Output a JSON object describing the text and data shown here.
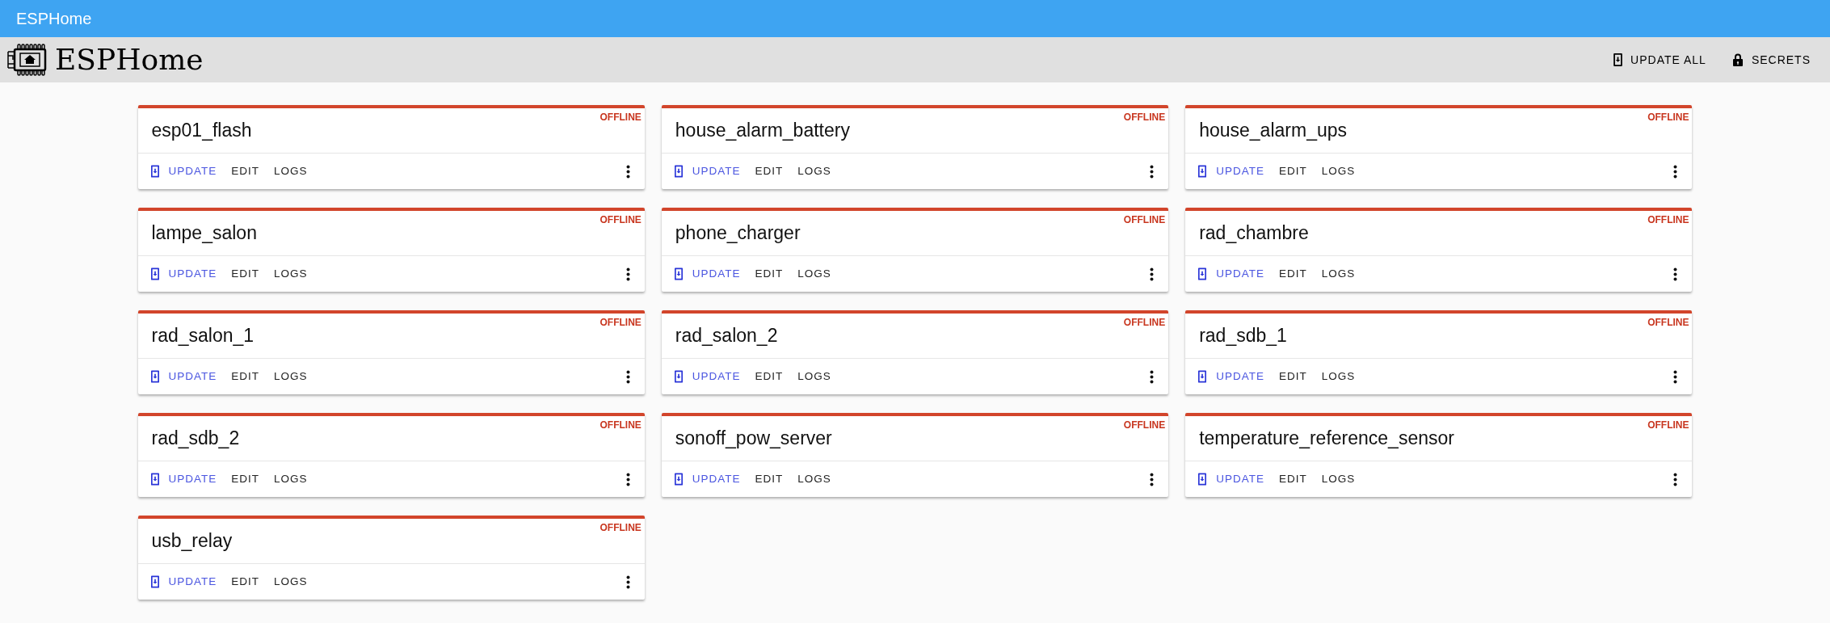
{
  "top_bar": {
    "title": "ESPHome"
  },
  "header": {
    "title": "ESPHome",
    "actions": [
      {
        "kind": "update",
        "label": "UPDATE ALL"
      },
      {
        "kind": "lock",
        "label": "SECRETS"
      }
    ]
  },
  "devices": [
    {
      "name": "esp01_flash",
      "status": "OFFLINE",
      "online": false,
      "actions": [
        "UPDATE",
        "EDIT",
        "LOGS"
      ]
    },
    {
      "name": "house_alarm_battery",
      "status": "OFFLINE",
      "online": false,
      "actions": [
        "UPDATE",
        "EDIT",
        "LOGS"
      ]
    },
    {
      "name": "house_alarm_ups",
      "status": "OFFLINE",
      "online": false,
      "actions": [
        "UPDATE",
        "EDIT",
        "LOGS"
      ]
    },
    {
      "name": "lampe_salon",
      "status": "OFFLINE",
      "online": false,
      "actions": [
        "UPDATE",
        "EDIT",
        "LOGS"
      ]
    },
    {
      "name": "phone_charger",
      "status": "OFFLINE",
      "online": false,
      "actions": [
        "UPDATE",
        "EDIT",
        "LOGS"
      ]
    },
    {
      "name": "rad_chambre",
      "status": "OFFLINE",
      "online": false,
      "actions": [
        "UPDATE",
        "EDIT",
        "LOGS"
      ]
    },
    {
      "name": "rad_salon_1",
      "status": "OFFLINE",
      "online": false,
      "actions": [
        "UPDATE",
        "EDIT",
        "LOGS"
      ]
    },
    {
      "name": "rad_salon_2",
      "status": "OFFLINE",
      "online": false,
      "actions": [
        "UPDATE",
        "EDIT",
        "LOGS"
      ]
    },
    {
      "name": "rad_sdb_1",
      "status": "OFFLINE",
      "online": false,
      "actions": [
        "UPDATE",
        "EDIT",
        "LOGS"
      ]
    },
    {
      "name": "rad_sdb_2",
      "status": "OFFLINE",
      "online": false,
      "actions": [
        "UPDATE",
        "EDIT",
        "LOGS"
      ]
    },
    {
      "name": "sonoff_pow_server",
      "status": "OFFLINE",
      "online": false,
      "actions": [
        "UPDATE",
        "EDIT",
        "LOGS"
      ]
    },
    {
      "name": "temperature_reference_sensor",
      "status": "OFFLINE",
      "online": false,
      "actions": [
        "UPDATE",
        "EDIT",
        "LOGS"
      ]
    },
    {
      "name": "usb_relay",
      "status": "OFFLINE",
      "online": false,
      "actions": [
        "UPDATE",
        "EDIT",
        "LOGS"
      ]
    }
  ]
}
